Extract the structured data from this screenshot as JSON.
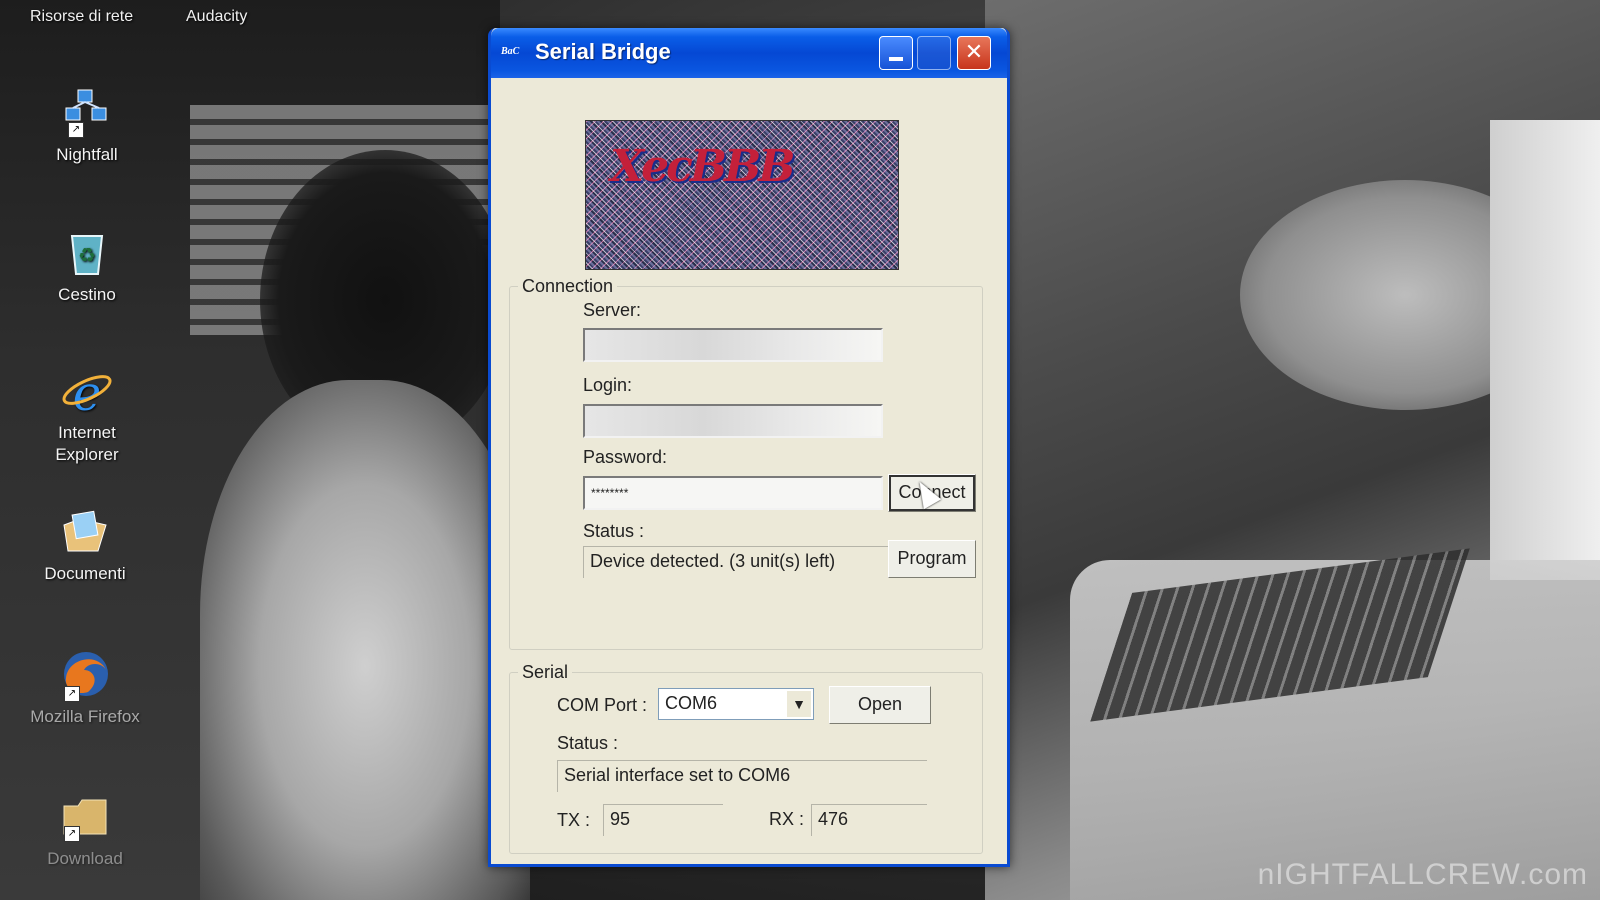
{
  "desktop": {
    "top_labels": [
      "Risorse di rete",
      "Audacity"
    ],
    "icons": [
      {
        "label": "Nightfall",
        "icon": "network-shortcut-icon"
      },
      {
        "label": "Cestino",
        "icon": "recycle-bin-icon"
      },
      {
        "label": "Internet Explorer",
        "icon": "internet-explorer-icon"
      },
      {
        "label": "Documenti",
        "icon": "documents-folder-icon"
      },
      {
        "label": "Mozilla Firefox",
        "icon": "firefox-icon"
      },
      {
        "label": "Download",
        "icon": "download-folder-icon"
      }
    ],
    "watermark": "nIGHTFALLCREW.com"
  },
  "window": {
    "title": "Serial Bridge",
    "title_icon_text": "BaC",
    "logo_text": "XecBBB",
    "close_glyph": "✕",
    "accent_color": "#0a4bd1"
  },
  "connection": {
    "group_label": "Connection",
    "server_label": "Server:",
    "server_value": "",
    "login_label": "Login:",
    "login_value": "",
    "password_label": "Password:",
    "password_value": "********",
    "connect_button": "Connect",
    "status_label": "Status :",
    "status_value": "Device detected. (3 unit(s) left)",
    "program_button": "Program"
  },
  "serial": {
    "group_label": "Serial",
    "com_port_label": "COM Port :",
    "com_port_value": "COM6",
    "open_button": "Open",
    "status_label": "Status :",
    "status_value": "Serial interface set to COM6",
    "tx_label": "TX :",
    "tx_value": "95",
    "rx_label": "RX :",
    "rx_value": "476"
  }
}
